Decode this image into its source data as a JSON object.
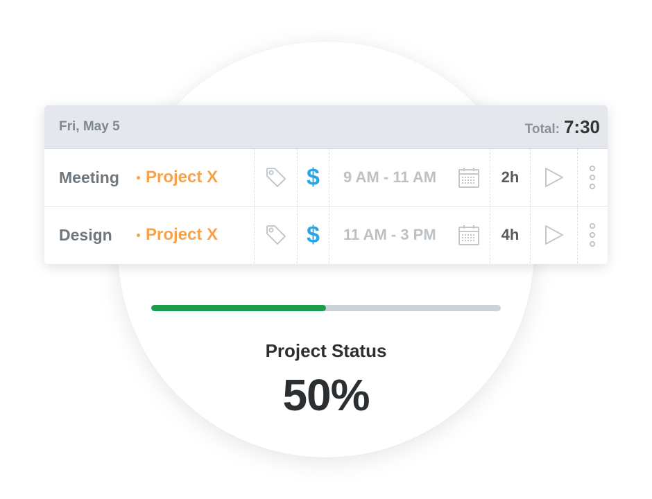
{
  "header": {
    "date": "Fri, May 5",
    "total_label": "Total:",
    "total_value": "7:30"
  },
  "entries": [
    {
      "description": "Meeting",
      "project": "Project X",
      "billable_icon": "$",
      "time_range": "9 AM - 11 AM",
      "duration": "2h"
    },
    {
      "description": "Design",
      "project": "Project X",
      "billable_icon": "$",
      "time_range": "11 AM - 3 PM",
      "duration": "4h"
    }
  ],
  "icons": {
    "tag": "tag-icon",
    "billable": "dollar-icon",
    "calendar": "calendar-icon",
    "play": "play-icon",
    "more": "more-vertical-icon"
  },
  "colors": {
    "project": "#f7a24a",
    "billable": "#2aa5e6",
    "progress_fill": "#1e9c4e",
    "progress_track": "#cbd2d8"
  },
  "status": {
    "label": "Project Status",
    "percent_text": "50%",
    "progress_fraction": 0.5
  }
}
